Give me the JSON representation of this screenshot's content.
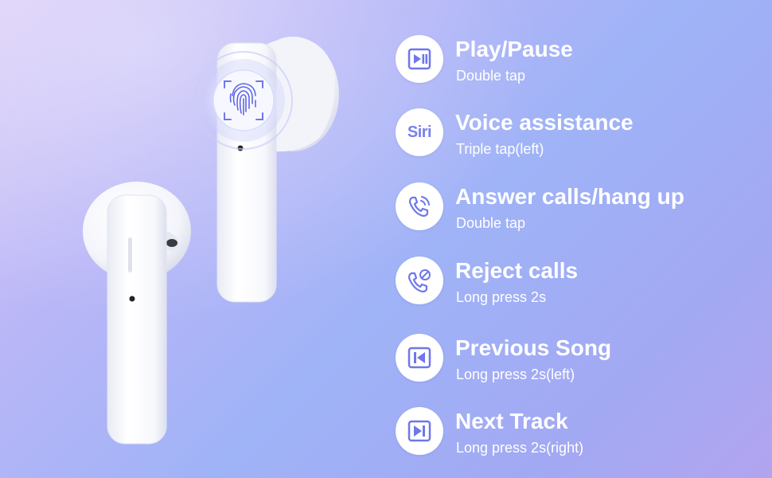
{
  "colors": {
    "icon_accent": "#6f77ea",
    "text": "#ffffff",
    "circle_bg": "#ffffff"
  },
  "earbuds": {
    "image": "two-white-earbuds",
    "touch_icon": "fingerprint-icon"
  },
  "features": [
    {
      "icon": "play-pause-icon",
      "title": "Play/Pause",
      "subtitle": "Double tap"
    },
    {
      "icon": "siri-icon",
      "icon_text": "Siri",
      "title": "Voice assistance",
      "subtitle": "Triple tap(left)"
    },
    {
      "icon": "phone-answer-icon",
      "title": "Answer calls/hang up",
      "subtitle": "Double tap"
    },
    {
      "icon": "phone-reject-icon",
      "title": "Reject calls",
      "subtitle": "Long press 2s"
    },
    {
      "icon": "previous-icon",
      "title": "Previous Song",
      "subtitle": "Long press 2s(left)"
    },
    {
      "icon": "next-icon",
      "title": "Next Track",
      "subtitle": "Long press 2s(right)"
    }
  ]
}
